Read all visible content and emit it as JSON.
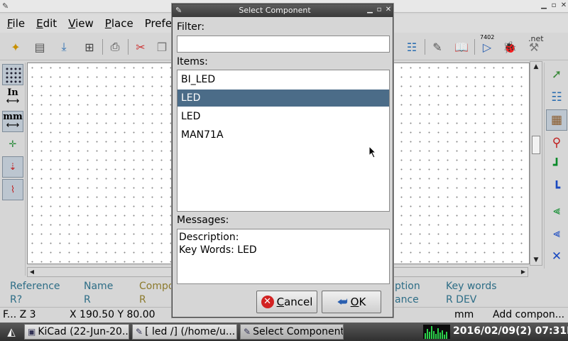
{
  "menubar": {
    "items": [
      {
        "ul": "F",
        "rest": "ile"
      },
      {
        "ul": "E",
        "rest": "dit"
      },
      {
        "ul": "V",
        "rest": "iew"
      },
      {
        "ul": "P",
        "rest": "lace"
      },
      {
        "ul": "",
        "rest": "Preferen"
      }
    ]
  },
  "left_toolbar": {
    "inch_label": "In",
    "mm_label": "mm"
  },
  "right_toolbar": {
    "chip_label": "7402",
    "net_label": ".net"
  },
  "info_panel": {
    "reference": {
      "label": "Reference",
      "value": "R?"
    },
    "name": {
      "label": "Name",
      "value": "R"
    },
    "component": {
      "label": "Compo",
      "value": "R"
    },
    "description": {
      "label": "ption",
      "value": "ance"
    },
    "keywords": {
      "label": "Key words",
      "value": "R DEV"
    }
  },
  "status_bar": {
    "zoom": "F... Z 3",
    "coords": "X 190.50  Y 80.00",
    "units": "mm",
    "mode": "Add compon..."
  },
  "dialog": {
    "title": "Select Component",
    "filter_label": "Filter:",
    "filter_value": "",
    "items_label": "Items:",
    "items": [
      "BI_LED",
      "LED",
      "LED",
      "MAN71A"
    ],
    "selected_index": 1,
    "messages_label": "Messages:",
    "description_line": "Description:",
    "keywords_line": "Key Words: LED",
    "cancel": {
      "ul": "C",
      "rest": "ancel"
    },
    "ok": {
      "ul": "O",
      "rest": "K"
    }
  },
  "taskbar": {
    "tasks": [
      "KiCad (22-Jun-20...",
      "[ led /] (/home/u...",
      "Select Component"
    ],
    "clock": "2016/02/09(2) 07:31PM"
  }
}
